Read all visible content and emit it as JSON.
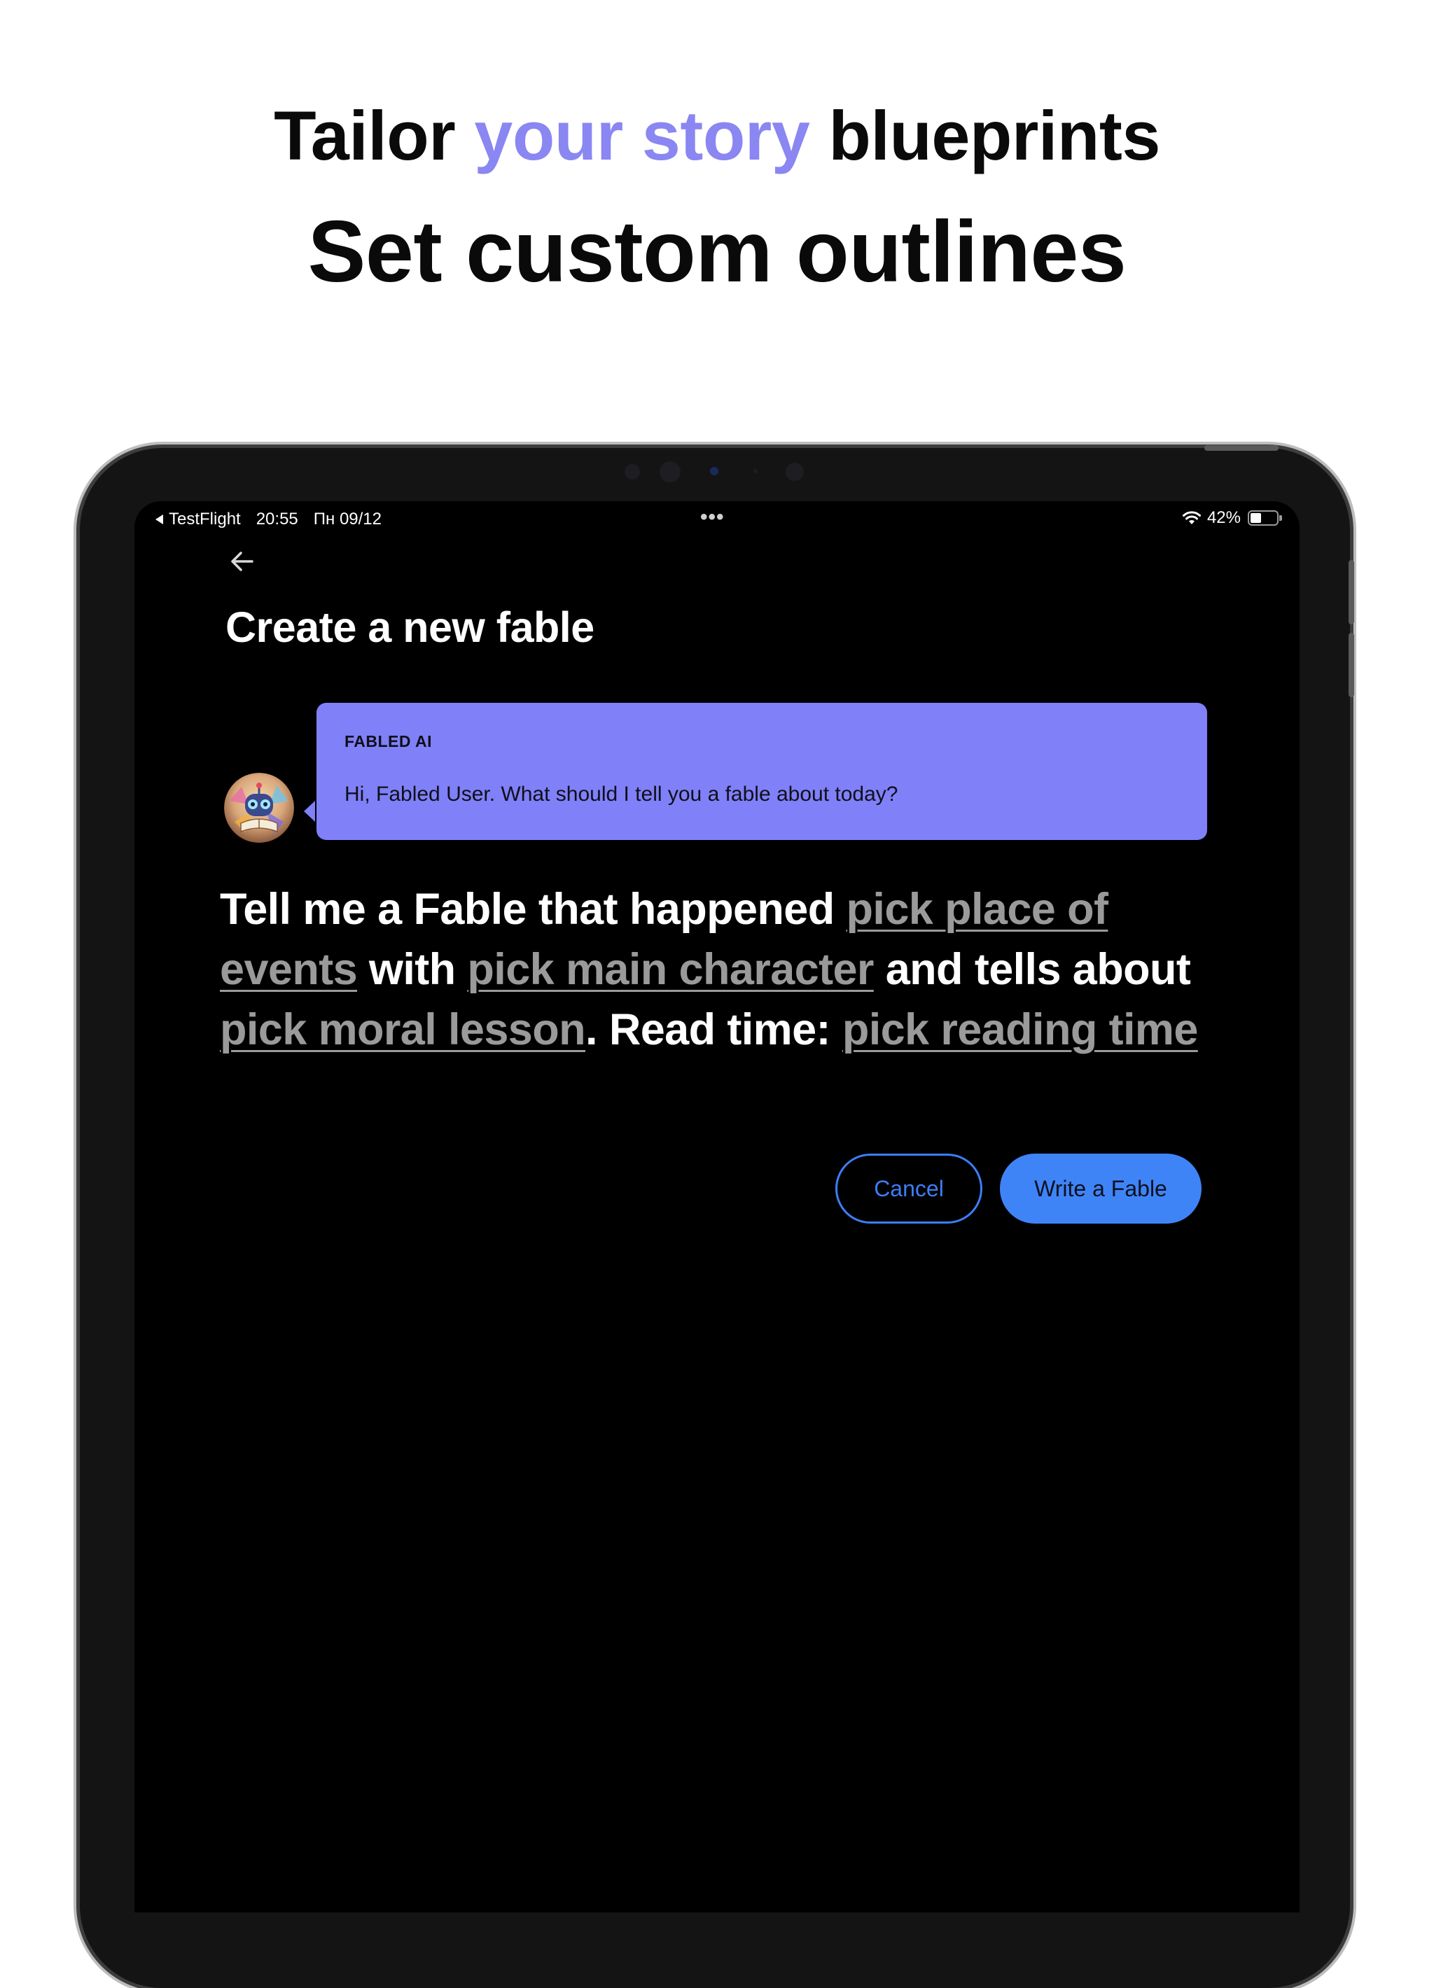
{
  "headline": {
    "line1_pre": "Tailor ",
    "line1_accent": "your story",
    "line1_post": " blueprints",
    "line2": "Set custom outlines"
  },
  "status_bar": {
    "app": "TestFlight",
    "time": "20:55",
    "date": "Пн 09/12",
    "dots": "•••",
    "battery": "42%",
    "battery_level": 0.42
  },
  "screen": {
    "title": "Create a new fable"
  },
  "chat": {
    "sender": "FABLED AI",
    "message": "Hi, Fabled User. What should I tell you a fable about today?"
  },
  "prompt": {
    "part1": "Tell me a Fable that happened ",
    "place": "pick place of events",
    "part2": " with ",
    "character": "pick main character",
    "part3": " and tells about ",
    "moral": "pick moral lesson",
    "part4": ". Read time: ",
    "reading_time": "pick reading time"
  },
  "buttons": {
    "cancel": "Cancel",
    "write": "Write a Fable"
  },
  "colors": {
    "accent_headline": "#8a86f2",
    "bubble": "#8080f8",
    "primary_button": "#3f84f7",
    "link_gray": "#9a9a9a"
  },
  "icons": {
    "back": "arrow-left-icon",
    "wifi": "wifi-icon",
    "battery": "battery-icon",
    "avatar": "robot-avatar"
  }
}
